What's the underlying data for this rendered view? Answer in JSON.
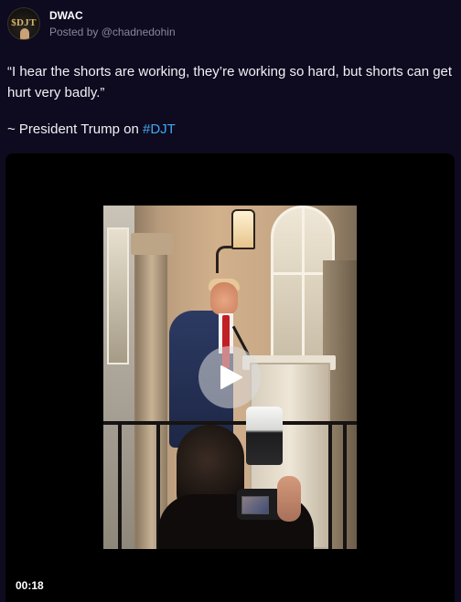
{
  "post": {
    "display_name": "DWAC",
    "posted_by": "Posted by @chadnedohin",
    "quote": "“I hear the shorts are working, they’re working so hard, but shorts can get hurt very badly.”",
    "attribution_prefix": "~ President Trump on ",
    "hashtag": "#DJT"
  },
  "avatar": {
    "logo_text": "$DJT",
    "icon": "avatar-icon"
  },
  "video": {
    "duration": "00:18",
    "play_icon": "play-icon"
  },
  "colors": {
    "background": "#0e0a1f",
    "hashtag": "#3fa9f5",
    "handle": "#8b8699"
  }
}
